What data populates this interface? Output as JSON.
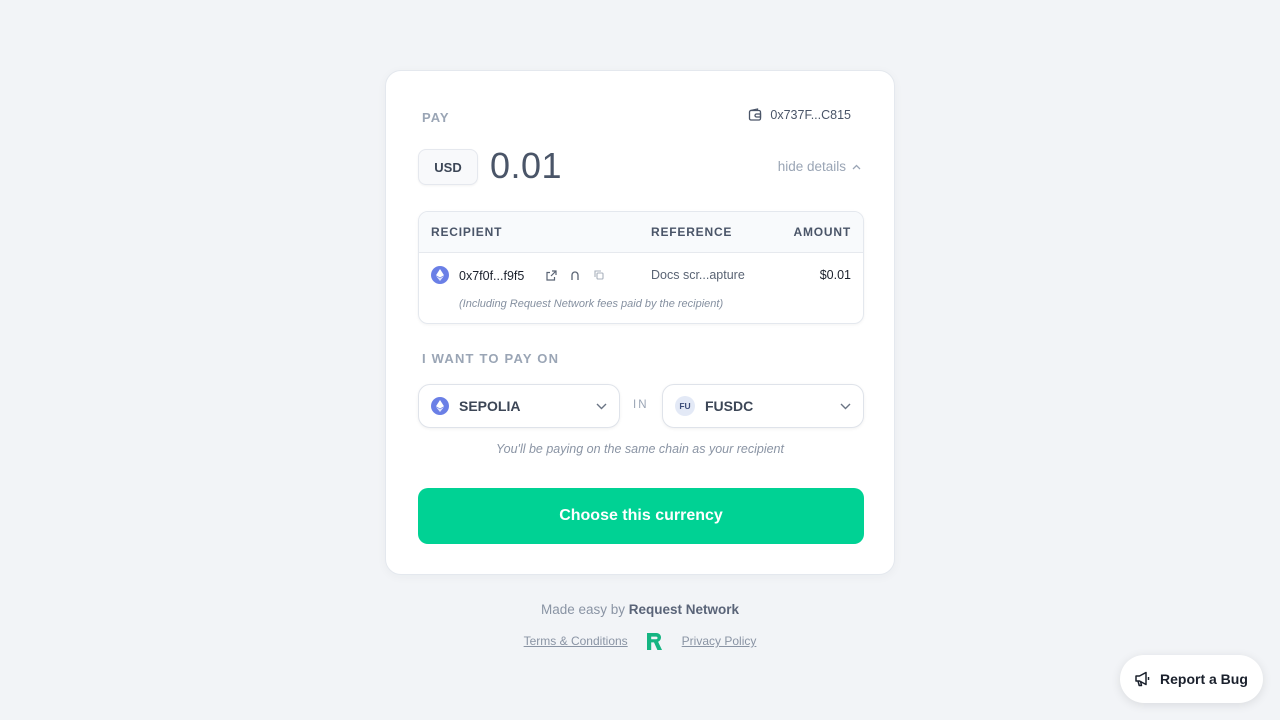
{
  "payment": {
    "label": "PAY",
    "wallet_address": "0x737F...C815",
    "currency": "USD",
    "amount": "0.01",
    "toggle_label": "hide details"
  },
  "details": {
    "headers": {
      "recipient": "RECIPIENT",
      "reference": "REFERENCE",
      "amount": "AMOUNT"
    },
    "row": {
      "recipient": "0x7f0f...f9f5",
      "reference": "Docs scr...apture",
      "amount": "$0.01"
    },
    "fees_note": "(Including Request Network fees paid by the recipient)"
  },
  "selection": {
    "label": "I WANT TO PAY ON",
    "network": "SEPOLIA",
    "in_label": "IN",
    "token_badge": "FU",
    "token": "FUSDC",
    "note": "You'll be paying on the same chain as your recipient"
  },
  "cta": {
    "label": "Choose this currency"
  },
  "footer": {
    "made_easy": "Made easy by",
    "brand": "Request Network",
    "terms": "Terms & Conditions",
    "privacy": "Privacy Policy"
  },
  "bug_report": {
    "label": "Report a Bug"
  },
  "colors": {
    "accent": "#00d294",
    "eth": "#6a7fe6",
    "background": "#f2f4f7"
  }
}
